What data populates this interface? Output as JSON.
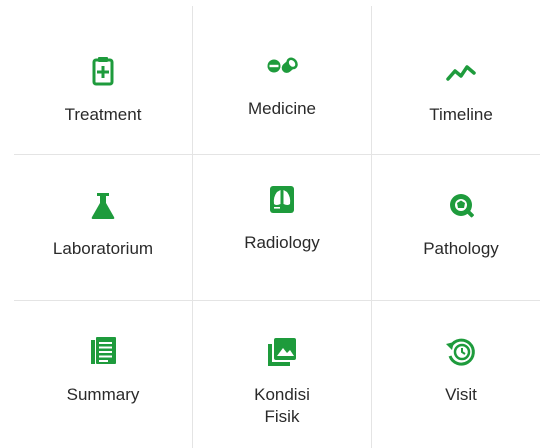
{
  "accent_color": "#1e9b3c",
  "menu": [
    {
      "label": "Treatment",
      "icon": "clipboard-plus-icon"
    },
    {
      "label": "Medicine",
      "icon": "pills-icon"
    },
    {
      "label": "Timeline",
      "icon": "trend-line-icon"
    },
    {
      "label": "Laboratorium",
      "icon": "flask-icon"
    },
    {
      "label": "Radiology",
      "icon": "lungs-xray-icon"
    },
    {
      "label": "Pathology",
      "icon": "microscope-slide-icon"
    },
    {
      "label": "Summary",
      "icon": "document-list-icon"
    },
    {
      "label": "Kondisi Fisik",
      "icon": "photo-library-icon"
    },
    {
      "label": "Visit",
      "icon": "history-clock-icon"
    }
  ]
}
